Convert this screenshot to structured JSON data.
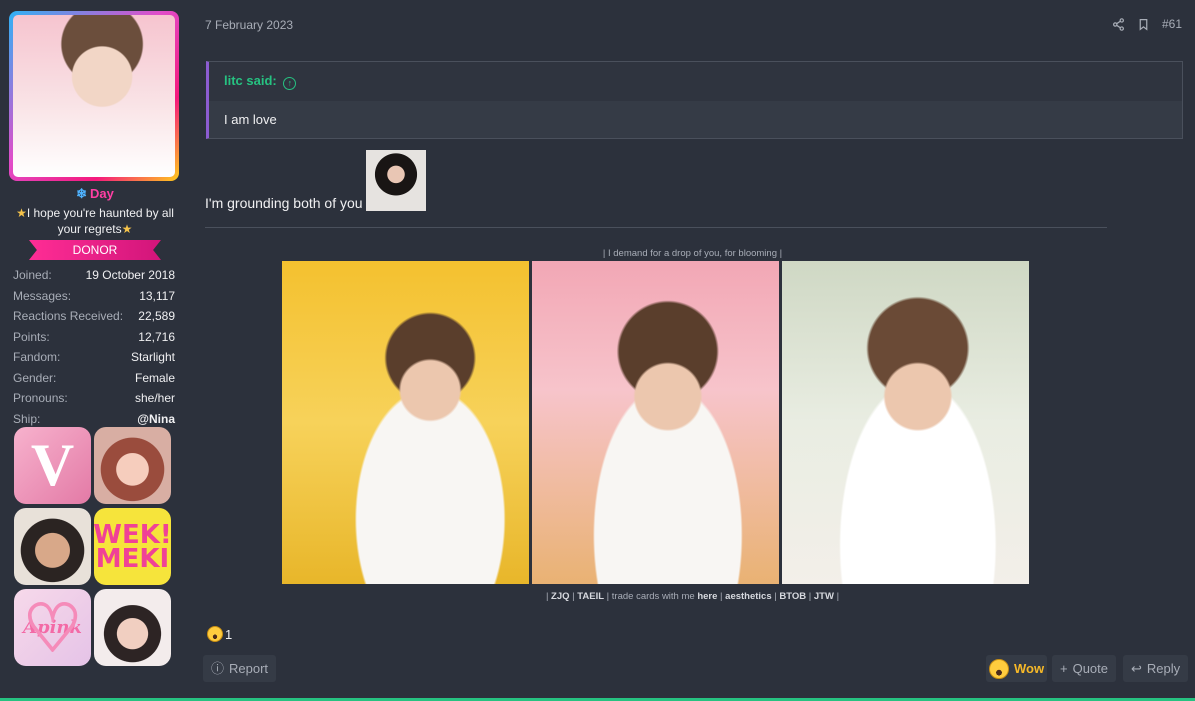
{
  "user": {
    "name": "Day",
    "title": "I hope you're haunted by all your regrets",
    "banner": "DONOR",
    "stats": [
      {
        "label": "Joined:",
        "value": "19 October 2018"
      },
      {
        "label": "Messages:",
        "value": "13,117"
      },
      {
        "label": "Reactions Received:",
        "value": "22,589"
      },
      {
        "label": "Points:",
        "value": "12,716"
      },
      {
        "label": "Fandom:",
        "value": "Starlight"
      },
      {
        "label": "Gender:",
        "value": "Female"
      },
      {
        "label": "Pronouns:",
        "value": "she/her"
      },
      {
        "label": "Ship:",
        "value": "@Nina"
      }
    ],
    "badges": {
      "b1": "V",
      "b4": "WEK! MEKI",
      "b5": "Apink"
    }
  },
  "post": {
    "date": "7 February 2023",
    "number": "#61",
    "quote": {
      "author": "litc said:",
      "text": "I am love"
    },
    "message": "I'm grounding both of you"
  },
  "signature": {
    "caption": "| I demand for a drop of you, for blooming |",
    "links": {
      "sep0": "|",
      "zjq": "ZJQ",
      "sep1": "|",
      "taeil": "TAEIL",
      "sep2": "| trade cards with me",
      "here": "here",
      "sep3": "|",
      "aesthetics": "aesthetics",
      "sep4": "|",
      "btob": "BTOB",
      "sep5": "|",
      "jtw": "JTW",
      "sep6": "|"
    }
  },
  "reactions": {
    "count": "1"
  },
  "footer": {
    "report": "Report",
    "wow": "Wow",
    "quote": "Quote",
    "reply": "Reply"
  },
  "colors": {
    "background": "#2c313c",
    "accent_green": "#26c281",
    "quote_border": "#8c5cd1",
    "username_pink": "#ff3fa4",
    "donor_pink": "#ff2d95",
    "wow_yellow": "#f7b928"
  }
}
